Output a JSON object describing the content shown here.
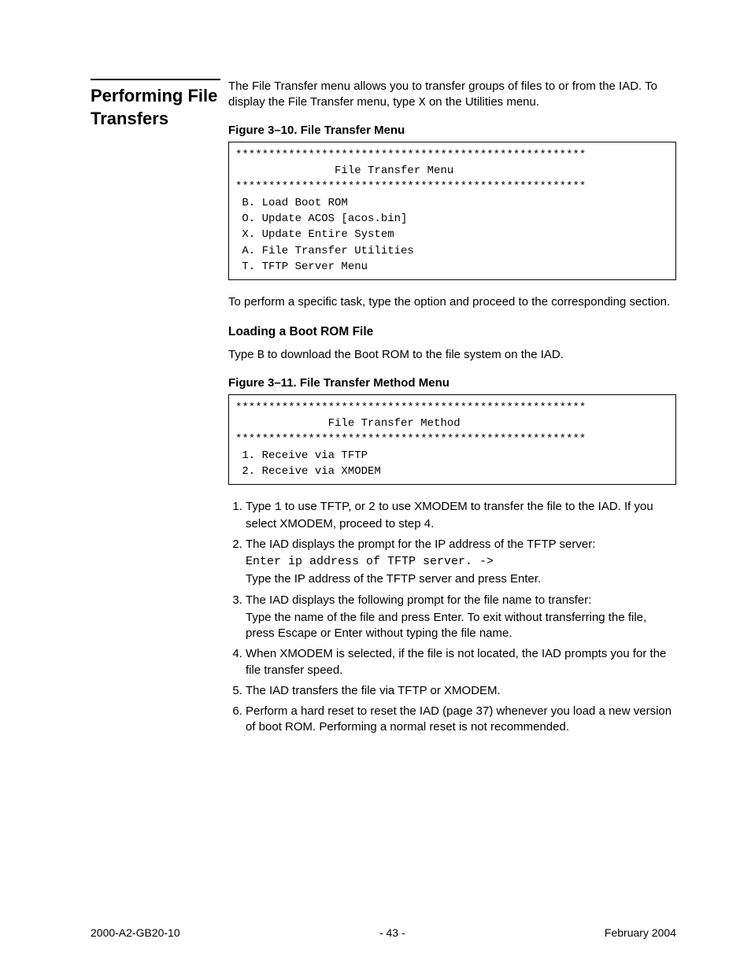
{
  "sidebar": {
    "heading": "Performing File Transfers"
  },
  "intro": {
    "paragraph_before": "The File Transfer menu allows you to transfer groups of files to or from the IAD. To display the File Transfer menu, type ",
    "key": "X",
    "paragraph_after": " on the Utilities menu."
  },
  "figure1": {
    "caption": "Figure 3–10.  File Transfer Menu",
    "content": "*****************************************************\n               File Transfer Menu\n*****************************************************\n B. Load Boot ROM\n O. Update ACOS [acos.bin]\n X. Update Entire System\n A. File Transfer Utilities\n T. TFTP Server Menu"
  },
  "after_fig1": "To perform a specific task, type the option and proceed to the corresponding section.",
  "subhead1": "Loading a Boot ROM File",
  "boot_para": {
    "before": "Type ",
    "key": "B",
    "after": " to download the Boot ROM to the file system on the IAD."
  },
  "figure2": {
    "caption": "Figure 3–11.  File Transfer Method Menu",
    "content": "*****************************************************\n              File Transfer Method\n*****************************************************\n 1. Receive via TFTP\n 2. Receive via XMODEM"
  },
  "steps": [
    {
      "pre": "Type ",
      "key": "1",
      "mid": " to use TFTP, or ",
      "key2": "2",
      "post": " to use XMODEM to transfer the file to the IAD. If you select XMODEM, proceed to step 4."
    },
    {
      "text": "The IAD displays the prompt for the IP address of the TFTP server:",
      "mono": "Enter ip address of TFTP server. ->",
      "after": "Type the IP address of the TFTP server and press Enter."
    },
    {
      "text": "The IAD displays the following prompt for the file name to transfer:",
      "after": "Type the name of the file and press Enter. To exit without transferring the file, press Escape or Enter without typing the file name."
    },
    {
      "text": "When XMODEM is selected, if the file is not located, the IAD prompts you for the file transfer speed."
    },
    {
      "text": "The IAD transfers the file via TFTP or XMODEM."
    },
    {
      "text": "Perform a hard reset to reset the IAD (page 37) whenever you load a new version of boot ROM. Performing a normal reset is not recommended."
    }
  ],
  "footer": {
    "left": "2000-A2-GB20-10",
    "center": "- 43 -",
    "right": "February 2004"
  }
}
